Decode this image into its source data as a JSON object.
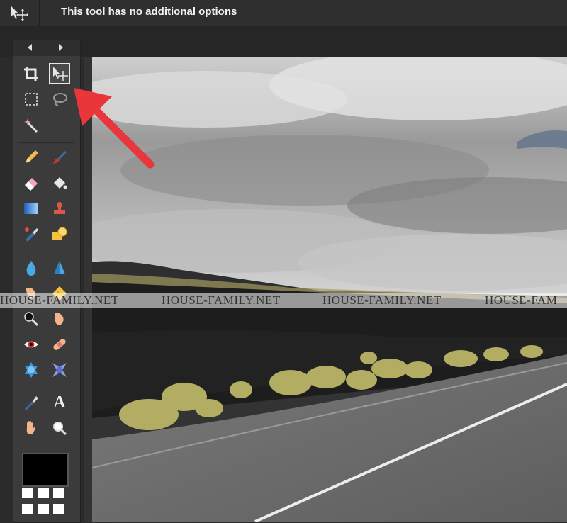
{
  "options_bar": {
    "tool_name": "move-tool",
    "message": "This tool has no additional options"
  },
  "toolbar": {
    "nav_prev": "◂",
    "nav_next": "▸",
    "tools": [
      {
        "name": "crop-tool",
        "icon": "crop-icon"
      },
      {
        "name": "move-tool",
        "icon": "move-icon",
        "active": true
      },
      {
        "name": "marquee-tool",
        "icon": "marquee-icon"
      },
      {
        "name": "lasso-tool",
        "icon": "lasso-icon"
      },
      {
        "name": "magic-wand-tool",
        "icon": "magic-wand-icon"
      },
      {
        "name": "pencil-tool",
        "icon": "pencil-icon"
      },
      {
        "name": "brush-tool",
        "icon": "brush-icon"
      },
      {
        "name": "eraser-tool",
        "icon": "eraser-icon"
      },
      {
        "name": "paint-bucket-tool",
        "icon": "paint-bucket-icon"
      },
      {
        "name": "gradient-tool",
        "icon": "gradient-icon"
      },
      {
        "name": "clone-stamp-tool",
        "icon": "stamp-icon"
      },
      {
        "name": "color-replace-tool",
        "icon": "color-replace-icon"
      },
      {
        "name": "shape-tool",
        "icon": "shape-icon"
      },
      {
        "name": "blur-tool",
        "icon": "drop-icon"
      },
      {
        "name": "sharpen-tool",
        "icon": "cone-icon"
      },
      {
        "name": "smudge-tool",
        "icon": "finger-icon"
      },
      {
        "name": "sponge-tool",
        "icon": "sponge-icon"
      },
      {
        "name": "dodge-tool",
        "icon": "dodge-icon"
      },
      {
        "name": "burn-tool",
        "icon": "burn-icon"
      },
      {
        "name": "red-eye-tool",
        "icon": "eye-icon"
      },
      {
        "name": "spot-heal-tool",
        "icon": "bandage-icon"
      },
      {
        "name": "bloat-tool",
        "icon": "bloat-icon"
      },
      {
        "name": "pinch-tool",
        "icon": "pinch-icon"
      },
      {
        "name": "color-picker-tool",
        "icon": "eyedropper-icon"
      },
      {
        "name": "type-tool",
        "icon": "type-icon",
        "glyph": "A"
      },
      {
        "name": "hand-tool",
        "icon": "hand-icon"
      },
      {
        "name": "zoom-tool",
        "icon": "zoom-icon"
      }
    ],
    "primary_color": "#000000"
  },
  "watermark": {
    "text": "HOUSE-FAMILY.NET",
    "text_partial": "HOUSE-FAM"
  },
  "colors": {
    "annotation_arrow": "#e8363a",
    "toolbar_bg": "#3b3b3b",
    "topbar_bg": "#2f2f2f"
  }
}
